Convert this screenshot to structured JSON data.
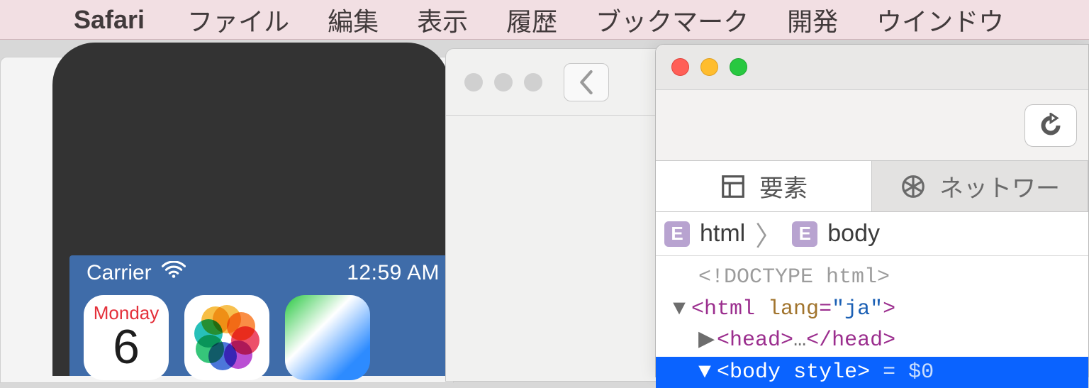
{
  "menubar": {
    "app": "Safari",
    "items": [
      "ファイル",
      "編集",
      "表示",
      "履歴",
      "ブックマーク",
      "開発",
      "ウインドウ"
    ]
  },
  "simulator": {
    "carrier": "Carrier",
    "time": "12:59 AM",
    "calendar": {
      "day": "Monday",
      "date": "6"
    }
  },
  "inspector": {
    "tabs": {
      "elements": "要素",
      "network": "ネットワー"
    },
    "breadcrumb": {
      "root": "html",
      "current": "body"
    },
    "dom": {
      "doctype": "<!DOCTYPE html>",
      "html_open": "html",
      "html_lang_attr": "lang",
      "html_lang_val": "\"ja\"",
      "head_open": "head",
      "head_ellipsis": "…",
      "head_close": "head",
      "body_open": "body",
      "body_attr": "style",
      "body_hint": "= $0"
    }
  }
}
